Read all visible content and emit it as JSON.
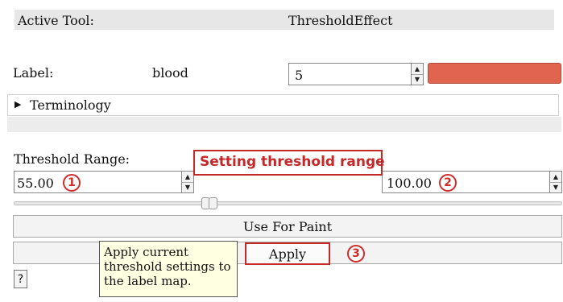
{
  "header": {
    "active_tool_label": "Active Tool:",
    "active_tool_value": "ThresholdEffect"
  },
  "label_row": {
    "label": "Label:",
    "label_name": "blood",
    "label_value": "5",
    "label_color": "#e0644e"
  },
  "terminology": {
    "label": "Terminology",
    "expanded": false
  },
  "threshold": {
    "label": "Threshold Range:",
    "min_value": "55.00",
    "max_value": "100.00",
    "min_badge": "1",
    "max_badge": "2"
  },
  "annotation": {
    "callout_text": "Setting threshold range",
    "apply_badge": "3",
    "accent_color": "#c62828"
  },
  "buttons": {
    "use_for_paint": "Use For Paint",
    "apply": "Apply",
    "help": "?"
  },
  "tooltip": {
    "lines": [
      "Apply current",
      "threshold settings to",
      "the label map."
    ]
  },
  "icons": {
    "terminology_toggle": "triangle-right-icon",
    "spin_up": "arrow-up-icon",
    "spin_down": "arrow-down-icon"
  }
}
